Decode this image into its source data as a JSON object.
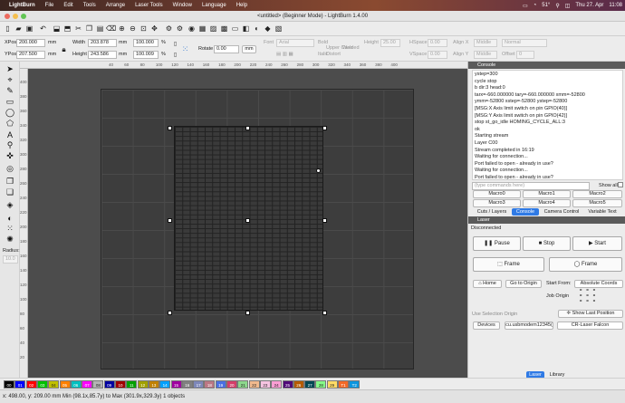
{
  "menubar": {
    "app": "LightBurn",
    "items": [
      "File",
      "Edit",
      "Tools",
      "Arrange",
      "Laser Tools",
      "Window",
      "Language",
      "Help"
    ],
    "status": [
      "51°",
      "Thu 27. Apr",
      "11:08"
    ]
  },
  "window": {
    "title": "<untitled> (Beginner Mode) - LightBurn 1.4.00"
  },
  "position": {
    "xpos_label": "XPos",
    "xpos": "200.000",
    "ypos_label": "YPos",
    "ypos": "207.500",
    "unit": "mm",
    "width_label": "Width",
    "width": "203.878",
    "height_label": "Height",
    "height": "243.586",
    "scale_w": "100.000",
    "scale_h": "100.009",
    "pct": "%",
    "rotate_label": "Rotate",
    "rotate": "0.00",
    "rotate_unit": "mm"
  },
  "text_options": {
    "font_label": "Font",
    "font": "Arial",
    "height_label": "Height",
    "height": "25.00",
    "hspace_label": "HSpace",
    "hspace": "0.00",
    "alignx_label": "Align X",
    "alignx": "Middle",
    "normal": "Normal",
    "bold": "Bold",
    "italic": "Italic",
    "uppercase": "Upper Case",
    "distort": "Distort",
    "welded": "Welded",
    "vspace_label": "VSpace",
    "vspace": "0.00",
    "aligny_label": "Align Y",
    "aligny": "Middle",
    "offset_label": "Offset",
    "offset": "0"
  },
  "lefttools": {
    "radius_label": "Radius:",
    "radius": "10.0"
  },
  "rulers": {
    "h": [
      "40",
      "60",
      "80",
      "100",
      "120",
      "140",
      "160",
      "180",
      "200",
      "220",
      "240",
      "260",
      "280",
      "300",
      "320",
      "340",
      "360",
      "380",
      "400"
    ],
    "v": [
      "400",
      "380",
      "360",
      "340",
      "320",
      "300",
      "280",
      "260",
      "240",
      "220",
      "200",
      "180",
      "160",
      "140",
      "120",
      "100",
      "80",
      "60",
      "40",
      "20"
    ]
  },
  "console": {
    "title": "Console",
    "lines": [
      "ystep=300",
      "cycle stop",
      "b dir:3 head:0",
      "tarx=-660.000000 tary=-660.000000 xmm=-52800",
      "ymm=-52800 xstep=-52800 ystep=-52800",
      "[MSG:X  Axis limit switch on pin GPIO(40)]",
      "[MSG:Y  Axis limit switch on pin GPIO(42)]",
      "stop st_go_idle HOMING_CYCLE_ALL:3",
      "ok",
      "Starting stream",
      "Layer C00",
      "Stream completed in 16:19",
      "Waiting for connection...",
      "Port failed to open - already in use?",
      "Waiting for connection...",
      "Port failed to open - already in use?",
      "Waiting for connection...",
      "Port failed to open - already in use?"
    ],
    "placeholder": "(type commands here)",
    "show_all": "Show all",
    "macros": [
      "Macro0",
      "Macro1",
      "Macro2",
      "Macro3",
      "Macro4",
      "Macro5"
    ]
  },
  "tabs": [
    "Cuts / Layers",
    "Console",
    "Camera Control",
    "Variable Text"
  ],
  "laser": {
    "title": "Laser",
    "status": "Disconnected",
    "pause": "Pause",
    "stop": "Stop",
    "start": "Start",
    "frame1": "Frame",
    "frame2": "Frame",
    "home": "Home",
    "go_origin": "Go to Origin",
    "start_from_label": "Start From:",
    "start_from": "Absolute Coords",
    "job_origin": "Job Origin",
    "use_selection": "Use Selection Origin",
    "show_last": "Show Last Position",
    "devices": "Devices",
    "port": "cu.usbmodem12345(",
    "device": "CR-Laser Falcon"
  },
  "bottom_tabs": [
    "Laser",
    "Library"
  ],
  "palette": [
    {
      "l": "00",
      "c": "#000000"
    },
    {
      "l": "01",
      "c": "#0000ff"
    },
    {
      "l": "02",
      "c": "#ff0000"
    },
    {
      "l": "03",
      "c": "#00c000"
    },
    {
      "l": "04",
      "c": "#c0c000"
    },
    {
      "l": "05",
      "c": "#ff8000"
    },
    {
      "l": "06",
      "c": "#00c0c0"
    },
    {
      "l": "07",
      "c": "#ff00ff"
    },
    {
      "l": "08",
      "c": "#b4b4b4"
    },
    {
      "l": "09",
      "c": "#0000a0"
    },
    {
      "l": "10",
      "c": "#a00000"
    },
    {
      "l": "11",
      "c": "#00a000"
    },
    {
      "l": "12",
      "c": "#a0a000"
    },
    {
      "l": "13",
      "c": "#c08000"
    },
    {
      "l": "14",
      "c": "#00a0ff"
    },
    {
      "l": "15",
      "c": "#a000a0"
    },
    {
      "l": "16",
      "c": "#808080"
    },
    {
      "l": "17",
      "c": "#7d87b9"
    },
    {
      "l": "18",
      "c": "#bb7784"
    },
    {
      "l": "19",
      "c": "#4a6fe3"
    },
    {
      "l": "20",
      "c": "#d33f6a"
    },
    {
      "l": "21",
      "c": "#8cd78c"
    },
    {
      "l": "22",
      "c": "#f0b98d"
    },
    {
      "l": "23",
      "c": "#f6c4e1"
    },
    {
      "l": "24",
      "c": "#fa9ed4"
    },
    {
      "l": "25",
      "c": "#500a78"
    },
    {
      "l": "26",
      "c": "#b45a00"
    },
    {
      "l": "27",
      "c": "#004754"
    },
    {
      "l": "28",
      "c": "#86fa88"
    },
    {
      "l": "29",
      "c": "#ffdb66"
    },
    {
      "l": "T1",
      "c": "#f36926"
    },
    {
      "l": "T2",
      "c": "#0c95de"
    }
  ],
  "status": {
    "text": "x: 498.00, y: 209.00 mm    Min (98.1x,85.7y) to Max (301.9x,329.3y)  1 objects"
  }
}
